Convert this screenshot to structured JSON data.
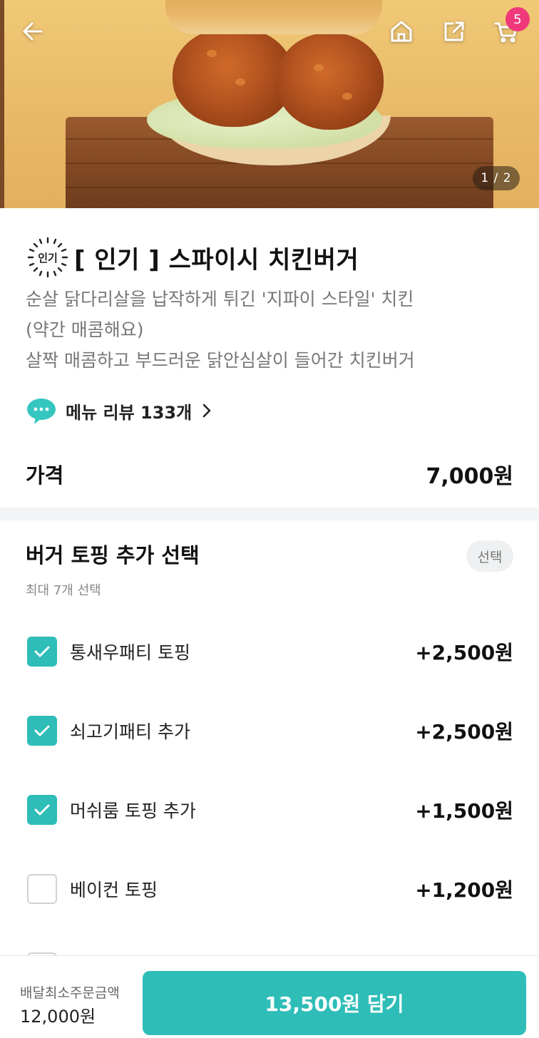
{
  "hero": {
    "image_counter": "1 / 2",
    "cart_count": "5",
    "icons": [
      "back-arrow-icon",
      "home-icon",
      "share-icon",
      "cart-icon"
    ]
  },
  "menu": {
    "popular_mark": "인기",
    "title": "[ 인기 ] 스파이시 치킨버거",
    "description": [
      "순살 닭다리살을 납작하게 튀긴 '지파이 스타일' 치킨",
      "(약간 매콤해요)",
      "살짝 매콤하고 부드러운 닭안심살이 들어간 치킨버거"
    ],
    "review_label": "메뉴 리뷰 133개",
    "price_label": "가격",
    "price_value": "7,000원"
  },
  "options": {
    "title": "버거 토핑 추가 선택",
    "subtitle": "최대 7개 선택",
    "badge": "선택",
    "items": [
      {
        "name": "통새우패티 토핑",
        "price": "+2,500원",
        "checked": true
      },
      {
        "name": "쇠고기패티 추가",
        "price": "+2,500원",
        "checked": true
      },
      {
        "name": "머쉬룸 토핑 추가",
        "price": "+1,500원",
        "checked": true
      },
      {
        "name": "베이컨 토핑",
        "price": "+1,200원",
        "checked": false
      }
    ]
  },
  "bottom": {
    "min_order_label": "배달최소주문금액",
    "min_order_value": "12,000원",
    "add_button": "13,500원 담기"
  },
  "colors": {
    "accent": "#2ebdb7",
    "badge": "#f0397a"
  }
}
